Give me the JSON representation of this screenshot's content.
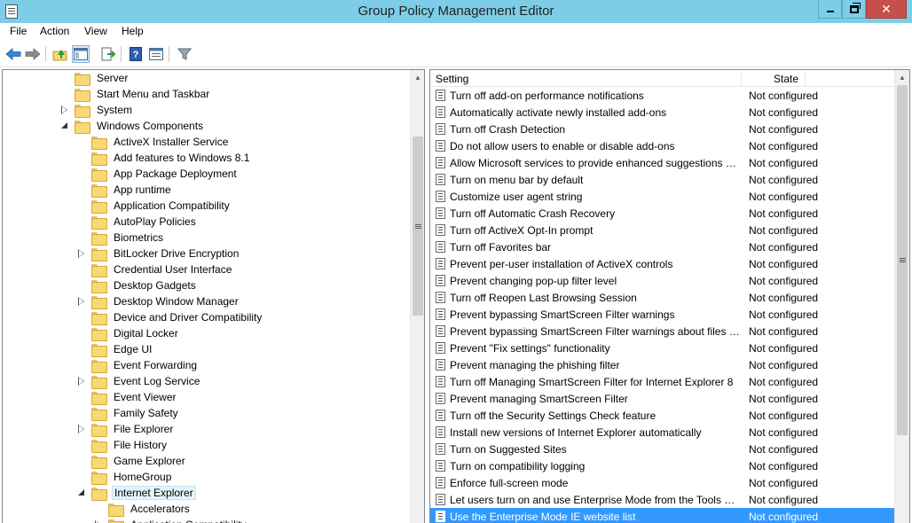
{
  "window": {
    "title": "Group Policy Management Editor"
  },
  "menu": [
    "File",
    "Action",
    "View",
    "Help"
  ],
  "toolbar": {
    "icons": [
      "back-arrow-icon",
      "forward-arrow-icon",
      "up-folder-icon",
      "show-hide-tree-icon",
      "export-list-icon",
      "help-icon",
      "properties-icon",
      "filter-icon"
    ]
  },
  "tree": {
    "items": [
      {
        "label": "Server",
        "level": 2,
        "expander": "none"
      },
      {
        "label": "Start Menu and Taskbar",
        "level": 2,
        "expander": "none"
      },
      {
        "label": "System",
        "level": 2,
        "expander": "collapsed"
      },
      {
        "label": "Windows Components",
        "level": 2,
        "expander": "expanded"
      },
      {
        "label": "ActiveX Installer Service",
        "level": 3,
        "expander": "none"
      },
      {
        "label": "Add features to Windows 8.1",
        "level": 3,
        "expander": "none"
      },
      {
        "label": "App Package Deployment",
        "level": 3,
        "expander": "none"
      },
      {
        "label": "App runtime",
        "level": 3,
        "expander": "none"
      },
      {
        "label": "Application Compatibility",
        "level": 3,
        "expander": "none"
      },
      {
        "label": "AutoPlay Policies",
        "level": 3,
        "expander": "none"
      },
      {
        "label": "Biometrics",
        "level": 3,
        "expander": "none"
      },
      {
        "label": "BitLocker Drive Encryption",
        "level": 3,
        "expander": "collapsed"
      },
      {
        "label": "Credential User Interface",
        "level": 3,
        "expander": "none"
      },
      {
        "label": "Desktop Gadgets",
        "level": 3,
        "expander": "none"
      },
      {
        "label": "Desktop Window Manager",
        "level": 3,
        "expander": "collapsed"
      },
      {
        "label": "Device and Driver Compatibility",
        "level": 3,
        "expander": "none"
      },
      {
        "label": "Digital Locker",
        "level": 3,
        "expander": "none"
      },
      {
        "label": "Edge UI",
        "level": 3,
        "expander": "none"
      },
      {
        "label": "Event Forwarding",
        "level": 3,
        "expander": "none"
      },
      {
        "label": "Event Log Service",
        "level": 3,
        "expander": "collapsed"
      },
      {
        "label": "Event Viewer",
        "level": 3,
        "expander": "none"
      },
      {
        "label": "Family Safety",
        "level": 3,
        "expander": "none"
      },
      {
        "label": "File Explorer",
        "level": 3,
        "expander": "collapsed"
      },
      {
        "label": "File History",
        "level": 3,
        "expander": "none"
      },
      {
        "label": "Game Explorer",
        "level": 3,
        "expander": "none"
      },
      {
        "label": "HomeGroup",
        "level": 3,
        "expander": "none"
      },
      {
        "label": "Internet Explorer",
        "level": 3,
        "expander": "expanded",
        "selected": true
      },
      {
        "label": "Accelerators",
        "level": 4,
        "expander": "none"
      },
      {
        "label": "Application Compatibility",
        "level": 4,
        "expander": "collapsed"
      }
    ]
  },
  "list": {
    "columns": {
      "setting": "Setting",
      "state": "State"
    },
    "rows": [
      {
        "setting": "Turn off add-on performance notifications",
        "state": "Not configured"
      },
      {
        "setting": "Automatically activate newly installed add-ons",
        "state": "Not configured"
      },
      {
        "setting": "Turn off Crash Detection",
        "state": "Not configured"
      },
      {
        "setting": "Do not allow users to enable or disable add-ons",
        "state": "Not configured"
      },
      {
        "setting": "Allow Microsoft services to provide enhanced suggestions a...",
        "state": "Not configured"
      },
      {
        "setting": "Turn on menu bar by default",
        "state": "Not configured"
      },
      {
        "setting": "Customize user agent string",
        "state": "Not configured"
      },
      {
        "setting": "Turn off Automatic Crash Recovery",
        "state": "Not configured"
      },
      {
        "setting": "Turn off ActiveX Opt-In prompt",
        "state": "Not configured"
      },
      {
        "setting": "Turn off Favorites bar",
        "state": "Not configured"
      },
      {
        "setting": "Prevent per-user installation of ActiveX controls",
        "state": "Not configured"
      },
      {
        "setting": "Prevent changing pop-up filter level",
        "state": "Not configured"
      },
      {
        "setting": "Turn off Reopen Last Browsing Session",
        "state": "Not configured"
      },
      {
        "setting": "Prevent bypassing SmartScreen Filter warnings",
        "state": "Not configured"
      },
      {
        "setting": "Prevent bypassing SmartScreen Filter warnings about files th...",
        "state": "Not configured"
      },
      {
        "setting": "Prevent \"Fix settings\" functionality",
        "state": "Not configured"
      },
      {
        "setting": "Prevent managing the phishing filter",
        "state": "Not configured"
      },
      {
        "setting": "Turn off Managing SmartScreen Filter for Internet Explorer 8",
        "state": "Not configured"
      },
      {
        "setting": "Prevent managing SmartScreen Filter",
        "state": "Not configured"
      },
      {
        "setting": "Turn off the Security Settings Check feature",
        "state": "Not configured"
      },
      {
        "setting": "Install new versions of Internet Explorer automatically",
        "state": "Not configured"
      },
      {
        "setting": "Turn on Suggested Sites",
        "state": "Not configured"
      },
      {
        "setting": "Turn on compatibility logging",
        "state": "Not configured"
      },
      {
        "setting": "Enforce full-screen mode",
        "state": "Not configured"
      },
      {
        "setting": "Let users turn on and use Enterprise Mode from the Tools m...",
        "state": "Not configured"
      },
      {
        "setting": "Use the Enterprise Mode IE website list",
        "state": "Not configured",
        "selected": true
      }
    ]
  },
  "colors": {
    "titlebar": "#7dcde8",
    "close_button": "#c74f4a",
    "selection": "#3399ff",
    "tree_selection": "#e5f3fb"
  }
}
